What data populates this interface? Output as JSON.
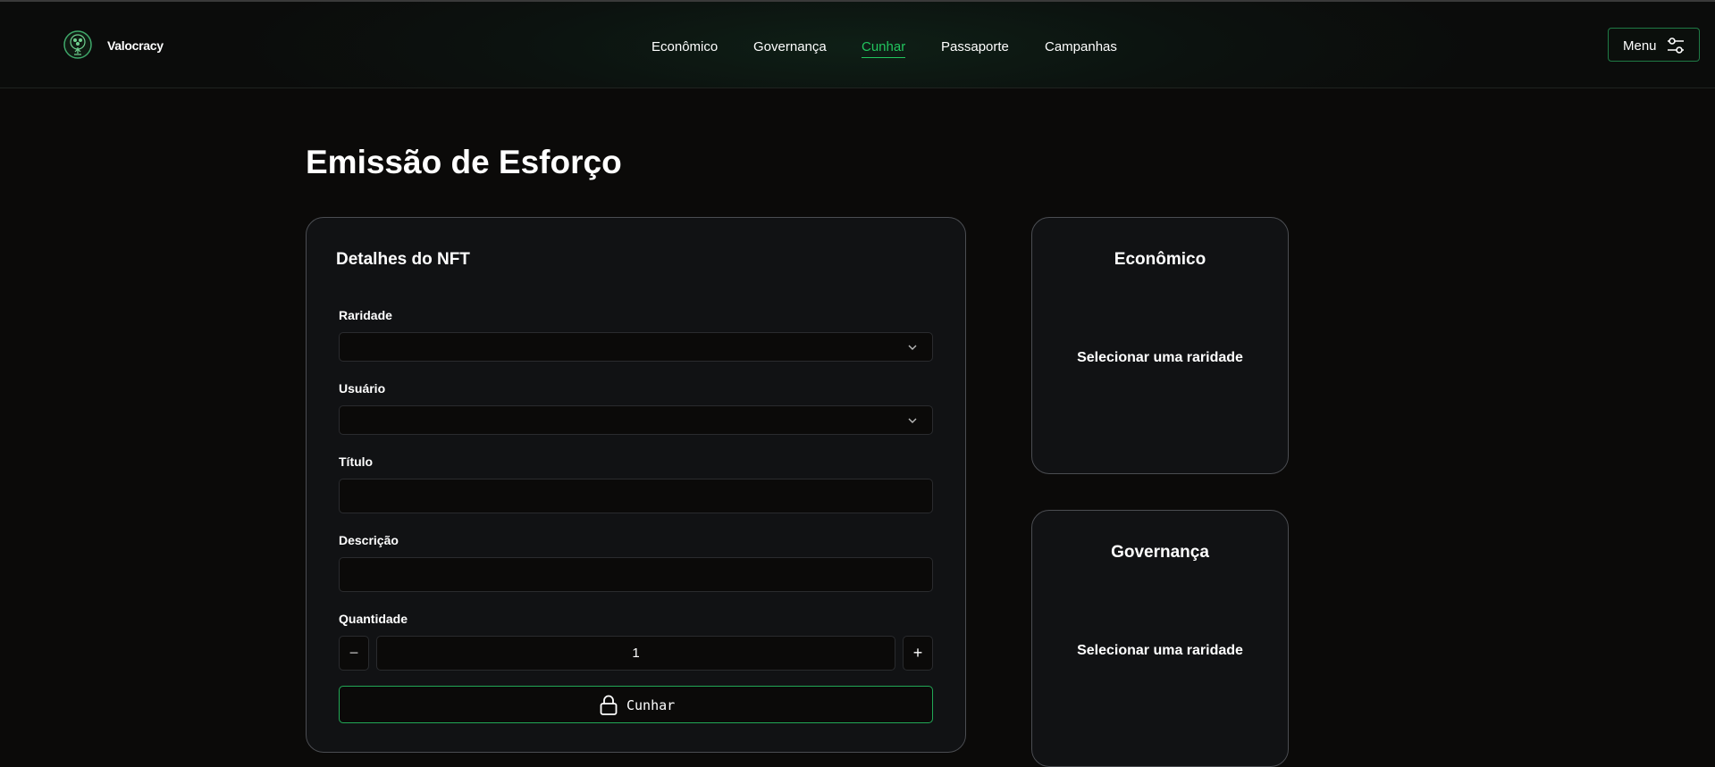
{
  "header": {
    "brand": "Valocracy",
    "nav": [
      {
        "label": "Econômico",
        "active": false
      },
      {
        "label": "Governança",
        "active": false
      },
      {
        "label": "Cunhar",
        "active": true
      },
      {
        "label": "Passaporte",
        "active": false
      },
      {
        "label": "Campanhas",
        "active": false
      }
    ],
    "menu_label": "Menu"
  },
  "page": {
    "title": "Emissão de Esforço"
  },
  "form": {
    "title": "Detalhes do NFT",
    "rarity_label": "Raridade",
    "rarity_value": "",
    "user_label": "Usuário",
    "user_value": "",
    "title_label": "Título",
    "title_value": "",
    "description_label": "Descrição",
    "description_value": "",
    "quantity_label": "Quantidade",
    "quantity_value": "1",
    "decrement": "−",
    "increment": "+",
    "mint_label": "Cunhar"
  },
  "side_cards": [
    {
      "title": "Econômico",
      "message": "Selecionar uma raridade"
    },
    {
      "title": "Governança",
      "message": "Selecionar uma raridade"
    }
  ],
  "colors": {
    "accent": "#22c55e",
    "background": "#0b0a09",
    "card": "#111214"
  },
  "icons": {
    "logo": "tree-emblem-icon",
    "menu": "sliders-icon",
    "select": "chevron-down-icon",
    "mint": "lock-icon"
  }
}
